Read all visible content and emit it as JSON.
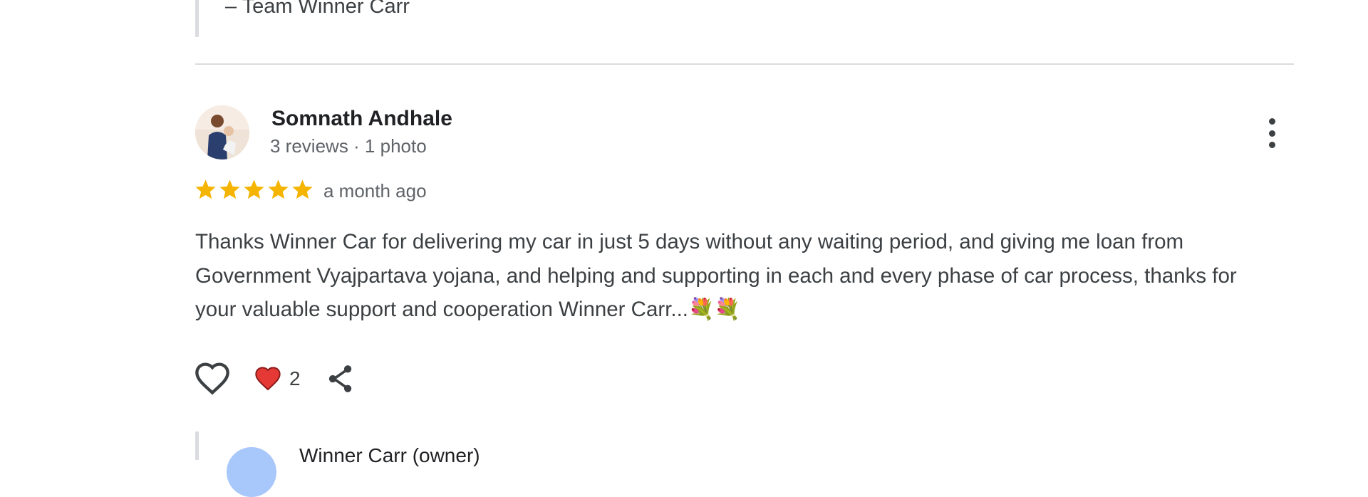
{
  "previous_reply": {
    "signature": "– Team Winner Carr"
  },
  "review": {
    "reviewer_name": "Somnath Andhale",
    "reviewer_meta": "3 reviews · 1 photo",
    "rating": 5,
    "rating_max": 5,
    "time": "a month ago",
    "text": "Thanks Winner Car for delivering my car in just 5 days without any waiting period, and giving me loan from Government Vyajpartava yojana, and helping and supporting in each and every phase of car process, thanks for your valuable support and cooperation Winner Carr...💐💐",
    "like_count": "2",
    "star_color": "#f4b400",
    "heart_color": "#e53935"
  },
  "owner_reply": {
    "name": "Winner Carr (owner)"
  },
  "icons": {
    "like": "heart-outline-icon",
    "reaction": "heart-filled-icon",
    "share": "share-icon",
    "more": "more-vert-icon"
  }
}
